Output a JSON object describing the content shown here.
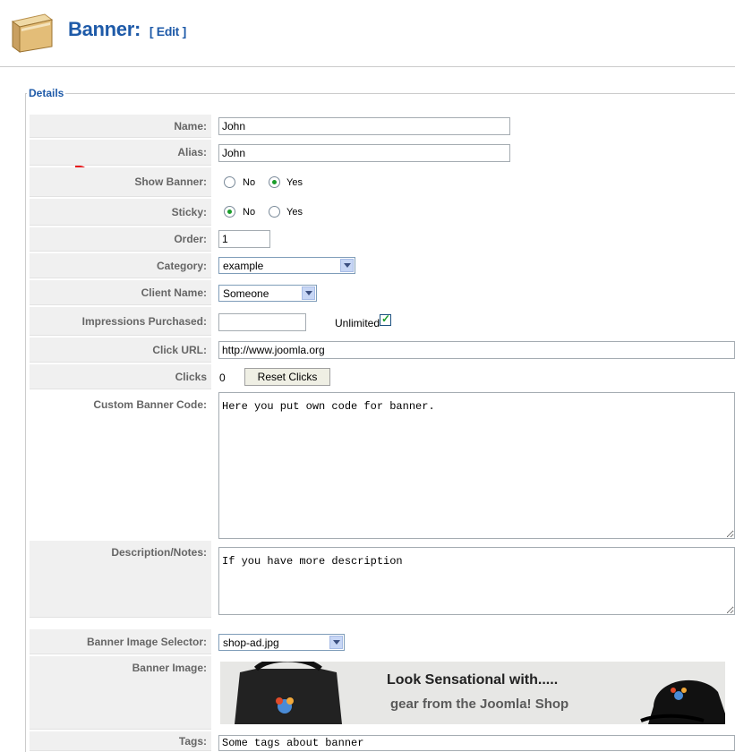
{
  "header": {
    "title": "Banner:",
    "edit_label": "[ Edit ]"
  },
  "fieldset": {
    "legend": "Details"
  },
  "annotation": "3",
  "form": {
    "name_label": "Name:",
    "name_value": "John",
    "alias_label": "Alias:",
    "alias_value": "John",
    "show_banner_label": "Show Banner:",
    "show_banner_no": "No",
    "show_banner_yes": "Yes",
    "sticky_label": "Sticky:",
    "sticky_no": "No",
    "sticky_yes": "Yes",
    "order_label": "Order:",
    "order_value": "1",
    "category_label": "Category:",
    "category_value": "example",
    "client_label": "Client Name:",
    "client_value": "Someone",
    "impressions_label": "Impressions Purchased:",
    "impressions_value": "",
    "unlimited_label": "Unlimited",
    "click_url_label": "Click URL:",
    "click_url_value": "http://www.joomla.org",
    "clicks_label": "Clicks",
    "clicks_value": "0",
    "reset_clicks_label": "Reset Clicks",
    "custom_code_label": "Custom Banner Code:",
    "custom_code_value": "Here you put own code for banner.",
    "description_label": "Description/Notes:",
    "description_value": "If you have more description",
    "image_selector_label": "Banner Image Selector:",
    "image_selector_value": "shop-ad.jpg",
    "banner_image_label": "Banner Image:",
    "tags_label": "Tags:",
    "tags_value": "Some tags about banner"
  },
  "banner_image": {
    "headline": "Look Sensational with.....",
    "subline": "gear from the Joomla! Shop"
  },
  "state": {
    "show_banner": "Yes",
    "sticky": "No",
    "unlimited_checked": true
  },
  "colors": {
    "title": "#1e5aa8",
    "annotation": "#e8181b",
    "label_bg": "#f0f0f0",
    "radio_selected": "#1a9d2a"
  },
  "icons": {
    "header": "box-icon",
    "select_arrow": "chevron-down-icon",
    "checkbox_tick": "checkmark-icon"
  }
}
